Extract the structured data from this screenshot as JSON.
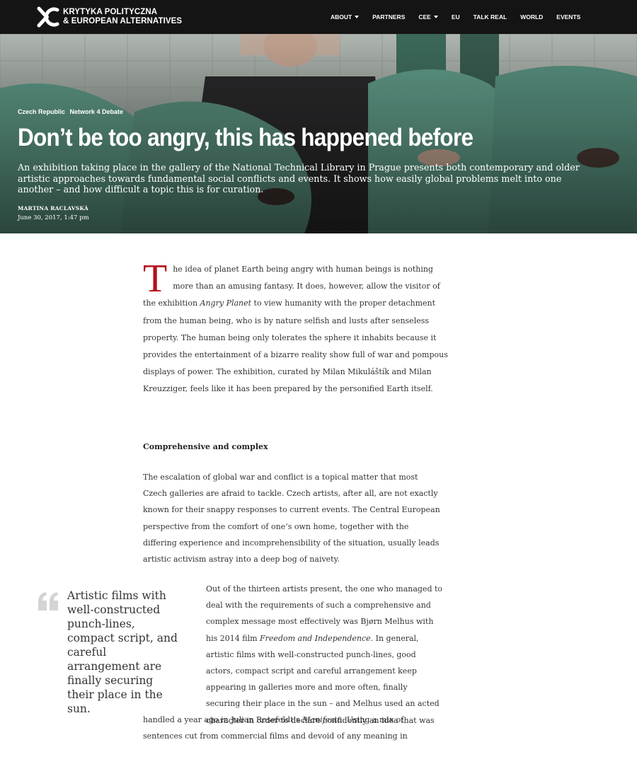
{
  "site": {
    "logo_line1": "KRYTYKA POLITYCZNA",
    "logo_line2": "& EUROPEAN ALTERNATIVES"
  },
  "nav": {
    "items": [
      {
        "label": "ABOUT",
        "dropdown": true
      },
      {
        "label": "PARTNERS",
        "dropdown": false
      },
      {
        "label": "CEE",
        "dropdown": true
      },
      {
        "label": "EU",
        "dropdown": false
      },
      {
        "label": "TALK REAL",
        "dropdown": false
      },
      {
        "label": "WORLD",
        "dropdown": false
      },
      {
        "label": "EVENTS",
        "dropdown": false
      }
    ]
  },
  "hero": {
    "tags": [
      "Czech Republic",
      "Network 4 Debate"
    ],
    "title": "Don’t be too angry, this has happened before",
    "lede": "An exhibition taking place in the gallery of the National Technical Library in Prague presents both contemporary and older artistic approaches towards fundamental social conflicts and events. It shows how easily global problems melt into one another – and how difficult a topic this is for curation.",
    "author": "MARTINA RACLAVSKÁ",
    "date": "June 30, 2017, 1:47 pm"
  },
  "article": {
    "dropcap": "T",
    "p1_start": "he idea of planet Earth being angry with human beings is nothing more than an amusing fantasy. It does, however, allow the visitor of the exhibition ",
    "p1_em": "Angry Planet",
    "p1_end": " to view humanity with the proper detachment from the human being, who is by nature selfish and lusts after senseless property. The human being only tolerates the sphere it inhabits because it provides the entertainment of a bizarre reality show full of war and pompous displays of power. The exhibition, curated by Milan Mikuláštík and Milan Kreuzziger, feels like it has been prepared by the personified Earth itself.",
    "subhead": "Comprehensive and complex",
    "p2": "The escalation of global war and conflict is a topical matter that most Czech galleries are afraid to tackle. Czech artists, after all, are not exactly known for their snappy responses to current events. The Central European perspective from the comfort of one’s own home, together with the differing experience and incomprehensibility of the situation, usually leads artistic activism astray into a deep bog of naivety.",
    "p3_start": "Out of the thirteen artists present, the one who managed to deal with the requirements of such a comprehensive and complex message most effectively was Bjørn Melhus with his 2014 film ",
    "p3_em": "Freedom and Independence",
    "p3_end": ". In general, artistic films with well-constructed punch-lines, good actors, compact script and careful arrangement keep appearing in galleries more and more often, finally securing their place in the sun – and Melhus used an acted character in order to declare confidently an idea that was",
    "p4_start": "handled a year ago in Julian Rosefeldt’s ",
    "p4_em": "Manifesto",
    "p4_end": ". Using a mix of sentences cut from commercial films and devoid of any meaning in",
    "pullquote": "Artistic films with well-constructed punch-lines, compact script, and careful arrangement are finally securing their place in the sun."
  },
  "colors": {
    "topbar": "#141414",
    "dropcap": "#b5121b",
    "hero_green": "#5e9a87"
  }
}
